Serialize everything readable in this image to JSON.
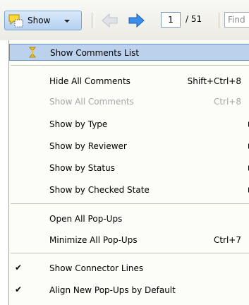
{
  "toolbar": {
    "show_label": "Show",
    "page_current": "1",
    "page_total": "/ 51",
    "find_placeholder": "Find"
  },
  "menu": {
    "items": [
      {
        "label": "Show Comments List",
        "icon": "comments-list-icon",
        "highlighted": true
      },
      {
        "label": "Hide All Comments",
        "shortcut": "Shift+Ctrl+8"
      },
      {
        "label": "Show All Comments",
        "shortcut": "Ctrl+8",
        "disabled": true
      },
      {
        "label": "Show by Type",
        "submenu": true
      },
      {
        "label": "Show by Reviewer",
        "submenu": true
      },
      {
        "label": "Show by Status",
        "submenu": true
      },
      {
        "label": "Show by Checked State",
        "submenu": true
      },
      {
        "label": "Open All Pop-Ups"
      },
      {
        "label": "Minimize All Pop-Ups",
        "shortcut": "Ctrl+7"
      },
      {
        "label": "Show Connector Lines",
        "checked": true
      },
      {
        "label": "Align New Pop-Ups by Default",
        "checked": true
      }
    ],
    "checkmark": "✔"
  },
  "colors": {
    "highlight": "#bcd1ec",
    "nav_arrow": "#3a8ee8",
    "disabled_text": "#a7a6aa"
  }
}
